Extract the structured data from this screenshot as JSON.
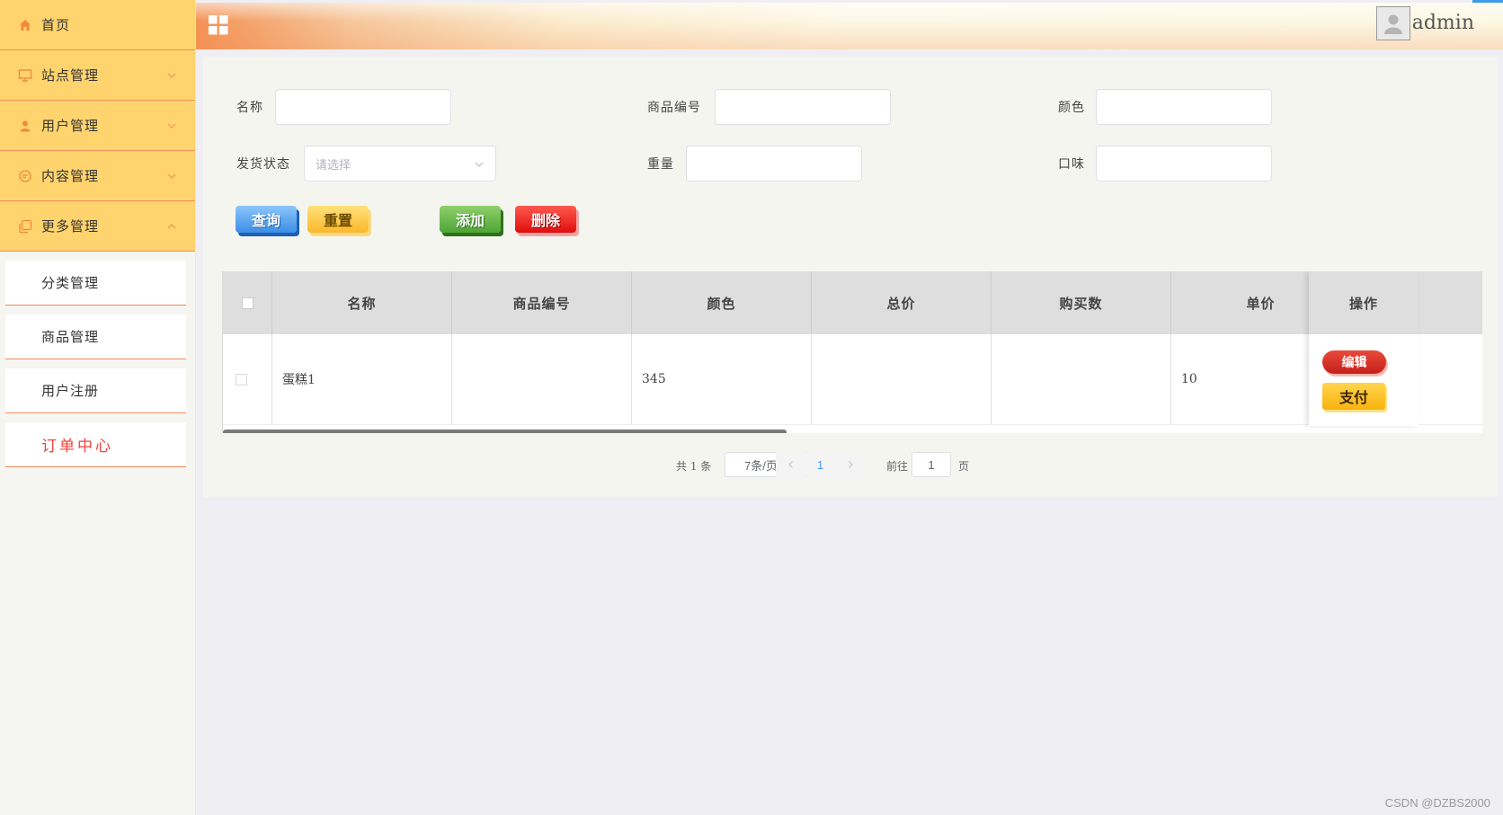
{
  "header": {
    "username": "admin"
  },
  "sidebar": {
    "items": [
      {
        "label": "首页",
        "icon": "home-icon"
      },
      {
        "label": "站点管理",
        "icon": "monitor-icon"
      },
      {
        "label": "用户管理",
        "icon": "user-icon"
      },
      {
        "label": "内容管理",
        "icon": "chat-icon"
      },
      {
        "label": "更多管理",
        "icon": "copy-icon"
      }
    ],
    "submenu": [
      {
        "label": "分类管理"
      },
      {
        "label": "商品管理"
      },
      {
        "label": "用户注册"
      },
      {
        "label": "订单中心",
        "active": true
      }
    ]
  },
  "filters": {
    "name_label": "名称",
    "code_label": "商品编号",
    "color_label": "颜色",
    "ship_label": "发货状态",
    "ship_placeholder": "请选择",
    "weight_label": "重量",
    "taste_label": "口味"
  },
  "buttons": {
    "query": "查询",
    "reset": "重置",
    "add": "添加",
    "delete": "删除",
    "edit": "编辑",
    "pay": "支付"
  },
  "table": {
    "headers": [
      "名称",
      "商品编号",
      "颜色",
      "总价",
      "购买数",
      "单价",
      "操作"
    ],
    "rows": [
      {
        "name": "蛋糕1",
        "code": "",
        "color": "345",
        "total": "",
        "qty": "",
        "price": "10"
      }
    ]
  },
  "pagination": {
    "total": "共 1 条",
    "page_size": "7条/页",
    "current": "1",
    "goto_label": "前往",
    "goto_value": "1",
    "page_suffix": "页"
  },
  "watermark": "CSDN @DZBS2000",
  "colors": {
    "sidebar_menu": "#ffd36d",
    "menu_border": "#f08d5c",
    "active_sub": "#f0413c",
    "primary_blue": "#409eff"
  }
}
